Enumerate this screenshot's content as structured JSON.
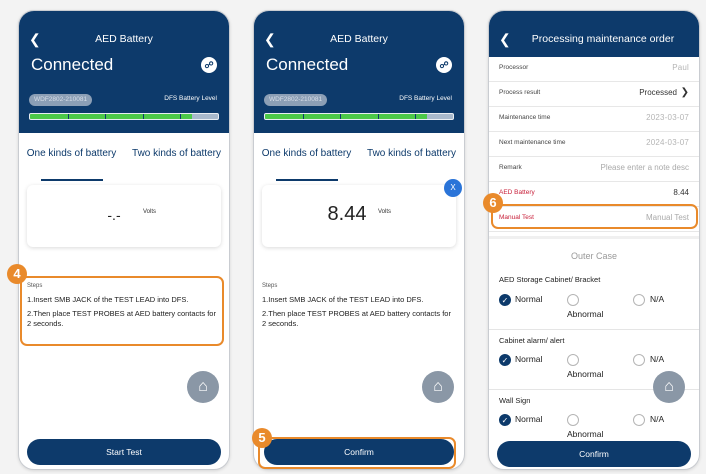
{
  "screens": [
    {
      "title": "AED Battery",
      "status": "Connected",
      "serial": "WDF2802-210081",
      "battery_label": "DFS Battery Level",
      "battery_level": 0.94,
      "tab_left": "One kinds of battery",
      "tab_right": "Two kinds of battery",
      "reading": "-.-",
      "reading_unit": "Volts",
      "steps_title": "Steps",
      "step1": "1.Insert SMB JACK of the TEST LEAD into DFS.",
      "step2": "2.Then place TEST PROBES at AED battery contacts for 2 seconds.",
      "button": "Start Test",
      "callout": "4"
    },
    {
      "title": "AED Battery",
      "status": "Connected",
      "serial": "WDF2802-210081",
      "battery_label": "DFS Battery Level",
      "battery_level": 0.94,
      "tab_left": "One kinds of battery",
      "tab_right": "Two kinds of battery",
      "reading": "8.44",
      "reading_unit": "Volts",
      "x_badge": "X",
      "steps_title": "Steps",
      "step1": "1.Insert SMB JACK of the TEST LEAD into DFS.",
      "step2": "2.Then place TEST PROBES at AED battery contacts for 2 seconds.",
      "button": "Confirm",
      "callout": "5"
    }
  ],
  "order": {
    "title": "Processing maintenance order",
    "rows": [
      {
        "label": "Processor",
        "value": "Paul"
      },
      {
        "label": "Process result",
        "value": "Processed"
      },
      {
        "label": "Maintenance time",
        "value": "2023-03-07"
      },
      {
        "label": "Next maintenance time",
        "value": "2024-03-07"
      },
      {
        "label": "Remark",
        "value": "Please enter a note desc"
      },
      {
        "label": "AED Battery",
        "value": "8.44"
      },
      {
        "label": "Manual Test",
        "value": "Manual Test"
      }
    ],
    "callout": "6",
    "section": "Outer Case",
    "questions": [
      {
        "label": "AED Storage Cabinet/ Bracket"
      },
      {
        "label": "Cabinet alarm/ alert"
      },
      {
        "label": "Wall Sign"
      }
    ],
    "options": {
      "normal": "Normal",
      "abnormal": "Abnormal",
      "na": "N/A"
    },
    "button": "Confirm"
  },
  "colors": {
    "navy": "#0d3a6b",
    "callout_orange": "#e98a2b",
    "battery_green": "#4cc948",
    "alert_red": "#c8203a"
  },
  "icons": {
    "back": "chevron-left-icon",
    "device": "defibrillator-icon",
    "home": "home-icon",
    "check": "check-icon"
  }
}
